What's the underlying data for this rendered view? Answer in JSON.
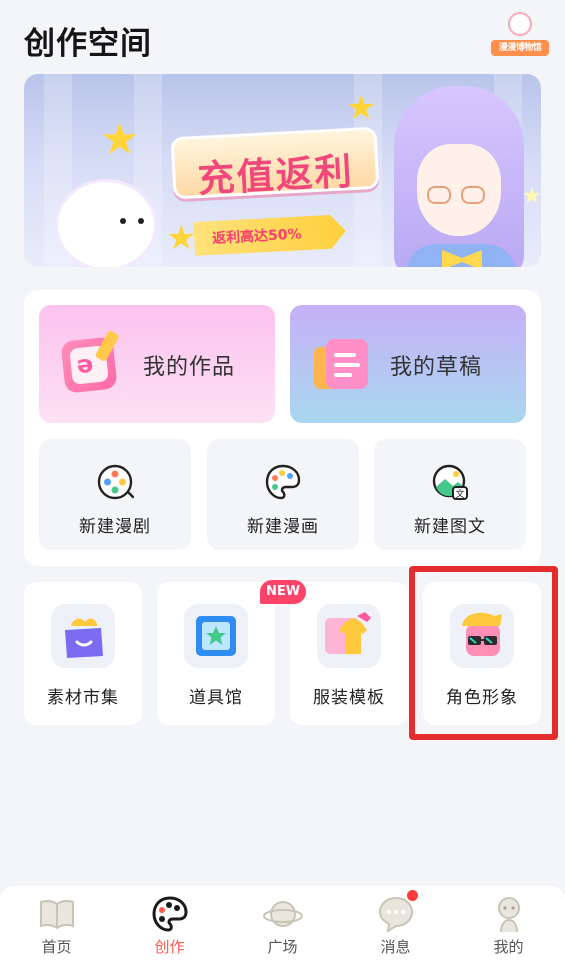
{
  "page": {
    "title": "创作空间"
  },
  "header": {
    "museum_badge_text": "漫漫博物馆"
  },
  "banner": {
    "title": "充值返利",
    "subtitle": "返利高达50%"
  },
  "works": {
    "my_works": "我的作品",
    "my_drafts": "我的草稿"
  },
  "create": [
    {
      "label": "新建漫剧",
      "icon": "film-reel-icon"
    },
    {
      "label": "新建漫画",
      "icon": "palette-icon"
    },
    {
      "label": "新建图文",
      "icon": "image-text-icon"
    }
  ],
  "tools": [
    {
      "label": "素材市集",
      "icon": "shopping-bag-icon"
    },
    {
      "label": "道具馆",
      "icon": "picture-frame-icon",
      "badge": "NEW"
    },
    {
      "label": "服装模板",
      "icon": "clothing-icon"
    },
    {
      "label": "角色形象",
      "icon": "character-avatar-icon"
    }
  ],
  "tabbar": {
    "items": [
      {
        "label": "首页",
        "icon": "book-icon",
        "active": false
      },
      {
        "label": "创作",
        "icon": "palette-icon",
        "active": true
      },
      {
        "label": "广场",
        "icon": "planet-icon",
        "active": false
      },
      {
        "label": "消息",
        "icon": "chat-bubble-icon",
        "active": false,
        "has_dot": true
      },
      {
        "label": "我的",
        "icon": "person-icon",
        "active": false
      }
    ]
  },
  "colors": {
    "accent": "#ff5a4e",
    "highlight": "#e42c2c",
    "badge": "#ff4267"
  }
}
